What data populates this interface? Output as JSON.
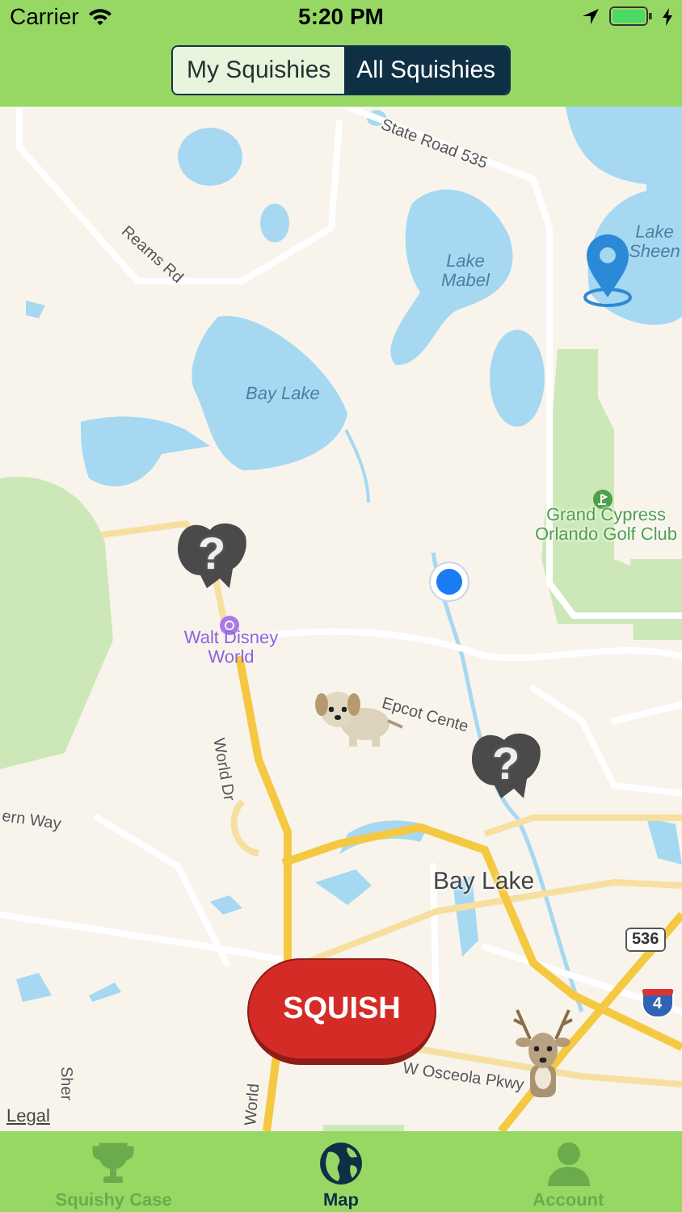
{
  "status_bar": {
    "carrier": "Carrier",
    "time": "5:20 PM"
  },
  "segments": [
    {
      "label": "My Squishies",
      "selected": false
    },
    {
      "label": "All Squishies",
      "selected": true
    }
  ],
  "map": {
    "labels": [
      {
        "text": "State Road 535",
        "kind": "road"
      },
      {
        "text": "Reams Rd",
        "kind": "road"
      },
      {
        "text": "Lake Mabel",
        "kind": "water"
      },
      {
        "text": "Lake Sheen",
        "kind": "water"
      },
      {
        "text": "Bay Lake",
        "kind": "water"
      },
      {
        "text": "Grand Cypress Orlando Golf Club",
        "kind": "park"
      },
      {
        "text": "Walt Disney World",
        "kind": "attraction"
      },
      {
        "text": "World Dr",
        "kind": "road"
      },
      {
        "text": "Epcot Cente",
        "kind": "road"
      },
      {
        "text": "ern Way",
        "kind": "road"
      },
      {
        "text": "Bay Lake",
        "kind": "town"
      },
      {
        "text": "536",
        "kind": "state-shield"
      },
      {
        "text": "4",
        "kind": "interstate-shield"
      },
      {
        "text": "W Osceola Pkwy",
        "kind": "road"
      },
      {
        "text": "World",
        "kind": "road"
      },
      {
        "text": "Sher",
        "kind": "road"
      },
      {
        "text": "Legal",
        "kind": "legal"
      }
    ],
    "squishies": [
      {
        "kind": "unknown",
        "mark": "?"
      },
      {
        "kind": "puppy"
      },
      {
        "kind": "unknown",
        "mark": "?"
      },
      {
        "kind": "deer"
      }
    ]
  },
  "squish_button": "SQUISH",
  "tabs": [
    {
      "label": "Squishy Case",
      "kind": "trophy",
      "selected": false
    },
    {
      "label": "Map",
      "kind": "globe",
      "selected": true
    },
    {
      "label": "Account",
      "kind": "person",
      "selected": false
    }
  ]
}
